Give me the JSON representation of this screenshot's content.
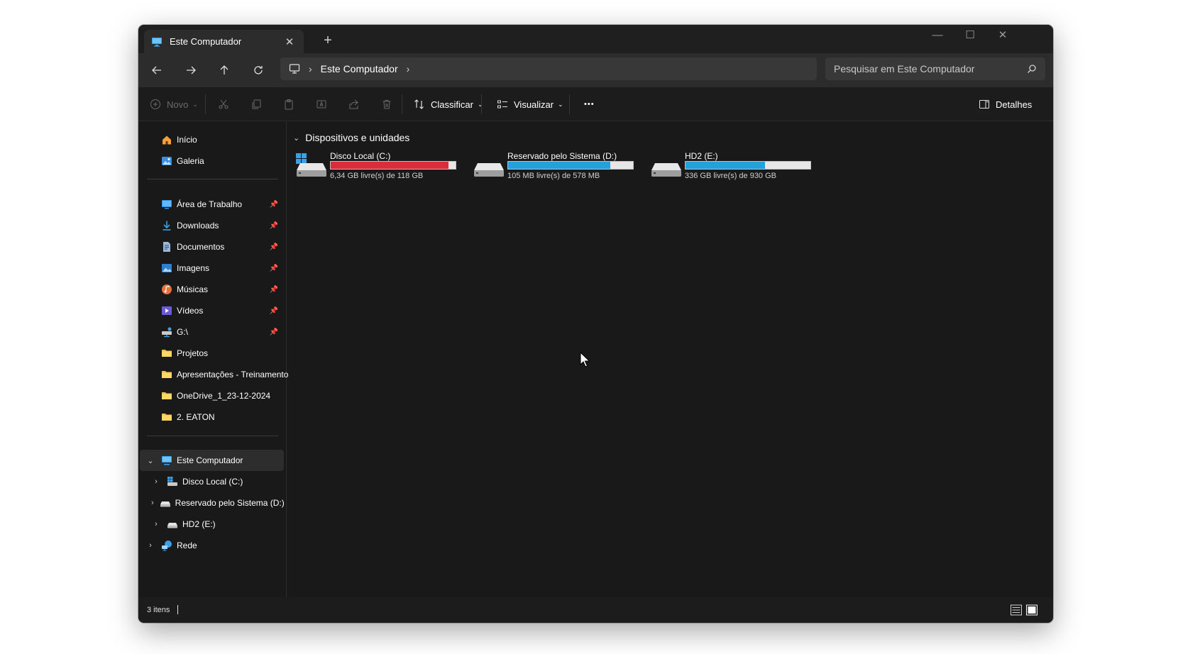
{
  "tab": {
    "title": "Este Computador",
    "close": "✕",
    "new_tab": "+"
  },
  "window_controls": {
    "minimize": "—",
    "maximize": "☐",
    "close": "✕"
  },
  "address_bar": {
    "location": "Este Computador"
  },
  "search": {
    "placeholder": "Pesquisar em Este Computador"
  },
  "toolbar": {
    "new_label": "Novo",
    "sort_label": "Classificar",
    "view_label": "Visualizar",
    "more_label": "•••",
    "details_label": "Detalhes"
  },
  "sidebar": {
    "quick": [
      {
        "label": "Início",
        "icon": "home-icon"
      },
      {
        "label": "Galeria",
        "icon": "gallery-icon"
      }
    ],
    "pinned": [
      {
        "label": "Área de Trabalho",
        "icon": "desktop-icon",
        "pinned": true
      },
      {
        "label": "Downloads",
        "icon": "download-icon",
        "pinned": true
      },
      {
        "label": "Documentos",
        "icon": "document-icon",
        "pinned": true
      },
      {
        "label": "Imagens",
        "icon": "pictures-icon",
        "pinned": true
      },
      {
        "label": "Músicas",
        "icon": "music-icon",
        "pinned": true
      },
      {
        "label": "Vídeos",
        "icon": "video-icon",
        "pinned": true
      },
      {
        "label": "G:\\",
        "icon": "network-drive-icon",
        "pinned": true
      },
      {
        "label": "Projetos",
        "icon": "folder-icon",
        "pinned": false
      },
      {
        "label": "Apresentações - Treinamento",
        "icon": "folder-icon",
        "pinned": false
      },
      {
        "label": "OneDrive_1_23-12-2024",
        "icon": "folder-icon",
        "pinned": false
      },
      {
        "label": "2. EATON",
        "icon": "folder-icon",
        "pinned": false
      }
    ],
    "tree": {
      "this_pc": "Este Computador",
      "drives": [
        "Disco Local (C:)",
        "Reservado pelo Sistema (D:)",
        "HD2 (E:)"
      ],
      "network": "Rede"
    }
  },
  "content": {
    "group_header": "Dispositivos e unidades",
    "drives": [
      {
        "name": "Disco Local (C:)",
        "free_text": "6,34 GB livre(s) de 118 GB",
        "used_fraction": 0.946,
        "bar_color": "#da2c3c"
      },
      {
        "name": "Reservado pelo Sistema (D:)",
        "free_text": "105 MB livre(s) de 578 MB",
        "used_fraction": 0.818,
        "bar_color": "#26a0da"
      },
      {
        "name": "HD2 (E:)",
        "free_text": "336 GB livre(s) de 930 GB",
        "used_fraction": 0.639,
        "bar_color": "#26a0da"
      }
    ]
  },
  "status": {
    "item_count": "3 itens"
  },
  "colors": {
    "accent": "#26a0da",
    "danger": "#da2c3c",
    "background": "#191919"
  }
}
